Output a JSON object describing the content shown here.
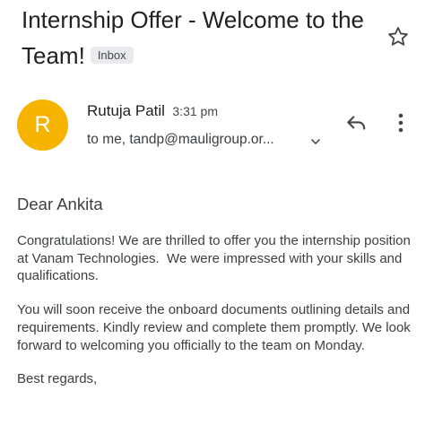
{
  "email": {
    "subject": "Internship Offer - Welcome to the Team!",
    "label_badge": "Inbox",
    "sender": {
      "name": "Rutuja Patil",
      "time": "3:31 pm",
      "avatar_initial": "R",
      "avatar_color": "#f6b400"
    },
    "recipients": "to me, tandp@mauligroup.or...",
    "body": {
      "greeting": "Dear Ankita",
      "paragraph_1": "Congratulations! We are thrilled to offer you the internship position at Vanam Technologies.  We were impressed with your skills and qualifications.",
      "paragraph_2": "You will soon receive the onboard documents outlining details and requirements. Kindly review and complete them promptly. We look forward to welcoming you officially to the team on Monday.",
      "signoff": "Best regards,"
    }
  },
  "icons": {
    "star": "star-icon",
    "reply": "reply-icon",
    "more": "more-vertical-icon",
    "expand": "chevron-down-icon"
  }
}
